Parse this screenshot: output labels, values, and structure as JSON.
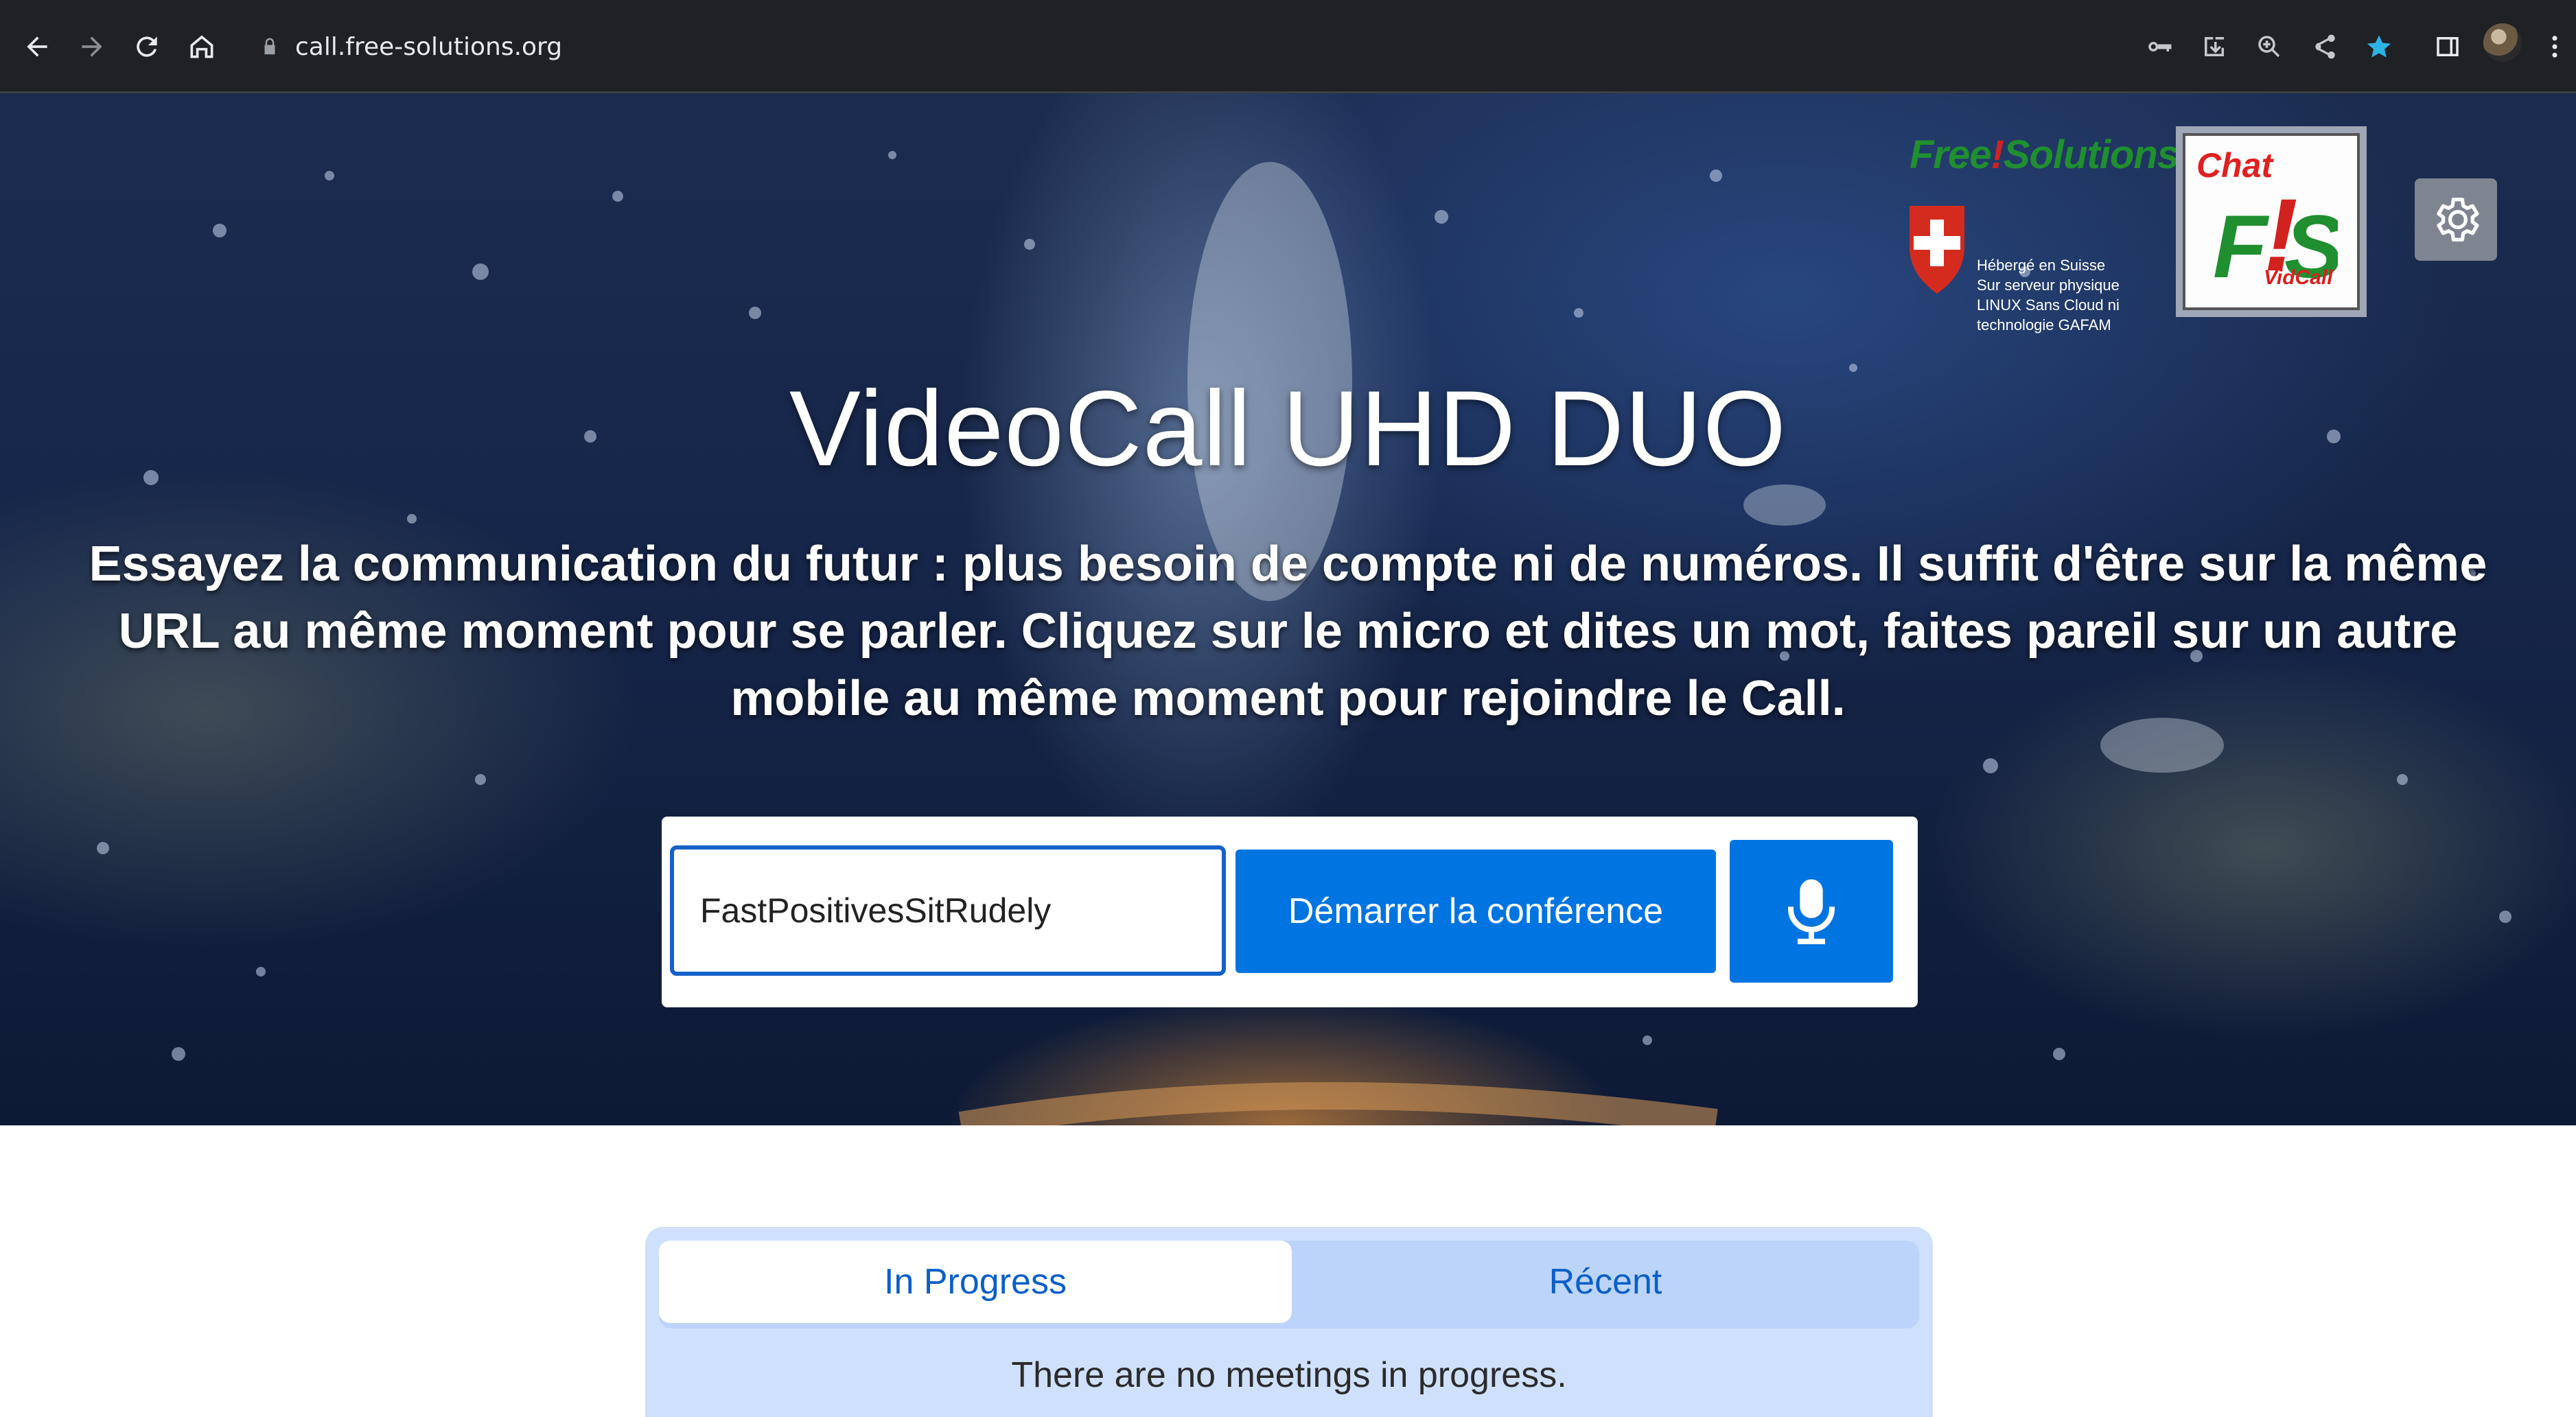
{
  "browser": {
    "url": "call.free-solutions.org",
    "icons": [
      "back-icon",
      "forward-icon",
      "reload-icon",
      "home-icon",
      "lock-icon",
      "key-icon",
      "install-icon",
      "zoom-icon",
      "share-icon",
      "bookmark-star-icon",
      "side-panel-icon",
      "profile-avatar",
      "menu-icon"
    ],
    "accent_star": "#2bb3e6"
  },
  "logos": {
    "free_solutions": {
      "title_a": "Free",
      "title_b": "!",
      "title_c": "Solutions",
      "note": [
        "Hébergé en Suisse",
        "Sur serveur physique",
        "LINUX Sans Cloud ni",
        "technologie GAFAM"
      ]
    },
    "chat": {
      "word": "Chat",
      "vidcall": "VidCall"
    }
  },
  "hero": {
    "title": "VideoCall UHD DUO",
    "subtitle": "Essayez la communication du futur : plus besoin de compte ni de numéros. Il suffit d'être sur la même URL au même moment pour se parler. Cliquez sur le micro et dites un mot, faites pareil sur un autre mobile au même moment pour rejoindre le Call."
  },
  "join": {
    "room_value": "FastPositivesSitRudely",
    "start_label": "Démarrer la conférence",
    "accent": "#0074e0"
  },
  "meetings": {
    "tabs": [
      "In Progress",
      "Récent"
    ],
    "active_tab": "In Progress",
    "empty_message": "There are no meetings in progress."
  }
}
